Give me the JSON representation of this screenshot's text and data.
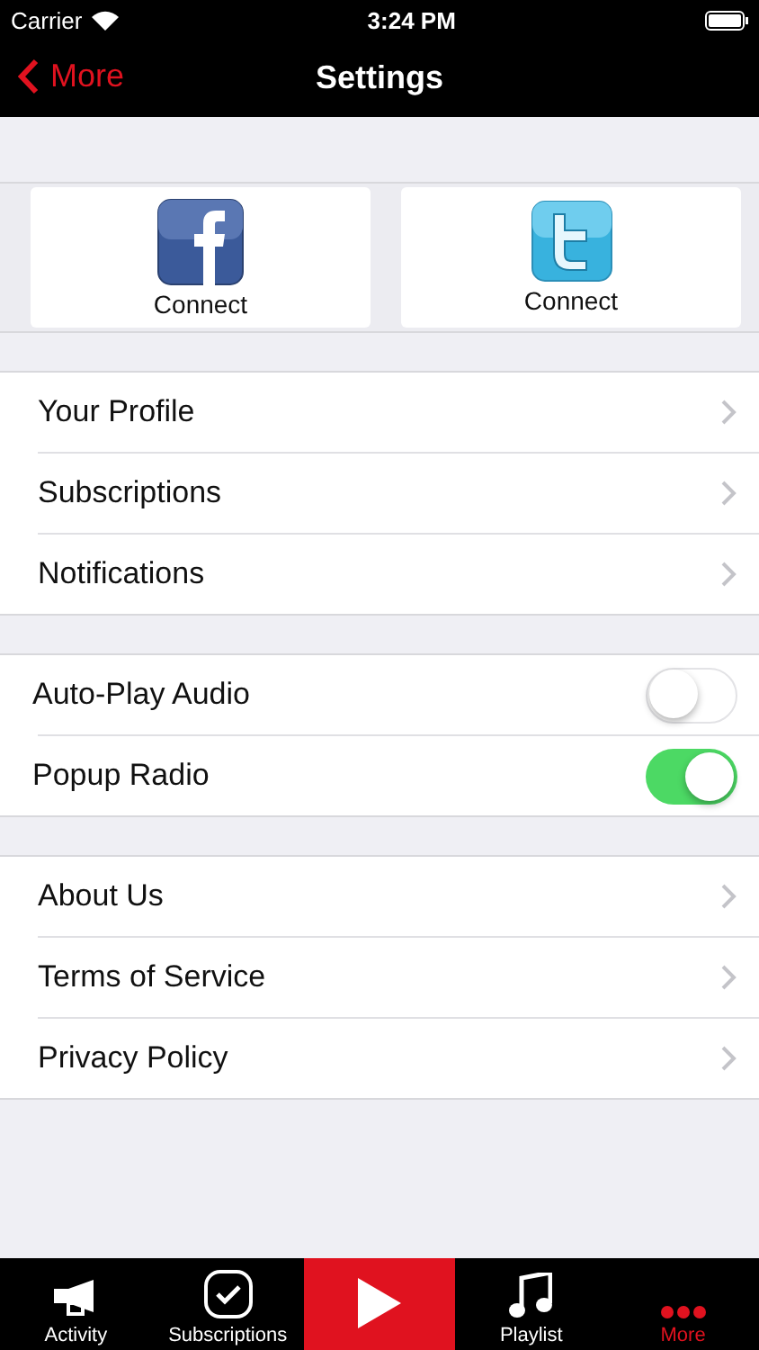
{
  "status_bar": {
    "carrier": "Carrier",
    "time": "3:24 PM"
  },
  "nav": {
    "back": "More",
    "title": "Settings"
  },
  "social": [
    {
      "kind": "facebook",
      "label": "Connect"
    },
    {
      "kind": "twitter",
      "label": "Connect"
    }
  ],
  "sections": [
    [
      {
        "kind": "link",
        "label": "Your Profile"
      },
      {
        "kind": "link",
        "label": "Subscriptions"
      },
      {
        "kind": "link",
        "label": "Notifications"
      }
    ],
    [
      {
        "kind": "toggle",
        "label": "Auto-Play Audio",
        "on": false
      },
      {
        "kind": "toggle",
        "label": "Popup Radio",
        "on": true
      }
    ],
    [
      {
        "kind": "link",
        "label": "About Us"
      },
      {
        "kind": "link",
        "label": "Terms of Service"
      },
      {
        "kind": "link",
        "label": "Privacy Policy"
      }
    ]
  ],
  "tabs": [
    {
      "kind": "megaphone",
      "label": "Activity",
      "selected": false
    },
    {
      "kind": "check",
      "label": "Subscriptions",
      "selected": false
    },
    {
      "kind": "play"
    },
    {
      "kind": "music",
      "label": "Playlist",
      "selected": false
    },
    {
      "kind": "dots",
      "label": "More",
      "selected": true
    }
  ]
}
